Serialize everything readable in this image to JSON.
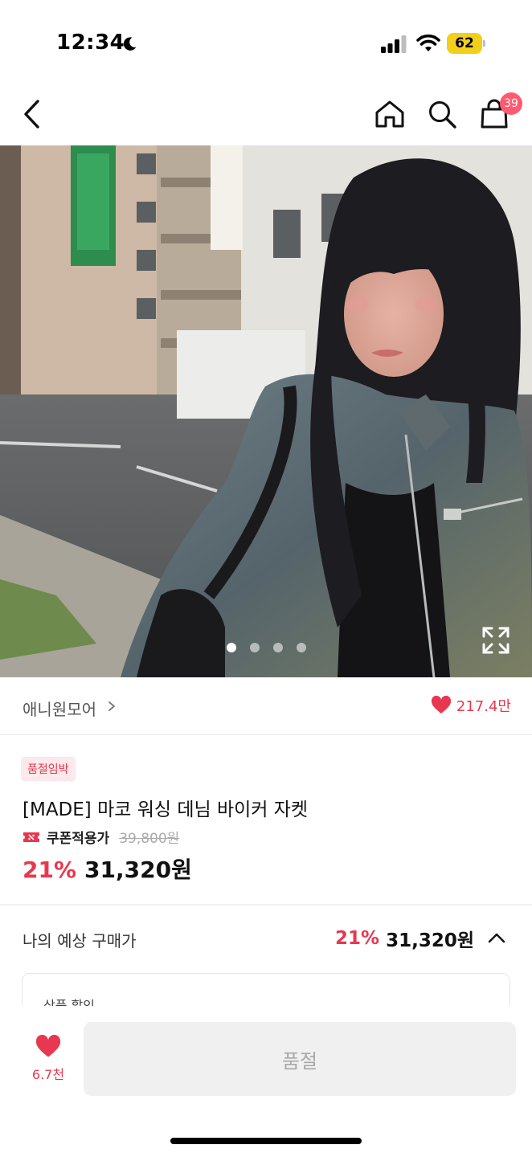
{
  "status_bar": {
    "time": "12:34",
    "battery": "62",
    "icons": [
      "moon-icon",
      "signal-icon",
      "wifi-icon",
      "battery-icon"
    ],
    "battery_color": "#f2cf1b"
  },
  "nav": {
    "icons": [
      "back-icon",
      "home-icon",
      "search-icon",
      "cart-icon"
    ],
    "cart_badge": "39"
  },
  "gallery": {
    "image": "photo of a woman with long black bangs wearing a washed denim biker jacket on a city street",
    "total_images": 4,
    "current_index": 1
  },
  "brand": {
    "name": "애니원모어",
    "likes": "217.4만"
  },
  "product": {
    "badge": "품절임박",
    "title": "[MADE] 마코 워싱 데님 바이커 자켓",
    "coupon_label": "쿠폰적용가",
    "original_price": "39,800원",
    "discount": "21%",
    "price": "31,320원"
  },
  "expected_price": {
    "label": "나의 예상 구매가",
    "discount": "21%",
    "price": "31,320원",
    "detail_label": "상품 할인"
  },
  "bottom": {
    "wish_count": "6.7천",
    "action_label": "품절"
  },
  "colors": {
    "accent": "#e8384f",
    "badge_bg": "#fde8eb",
    "cart_badge_bg": "#ff5a6f",
    "disabled_bg": "#f0f0f0"
  }
}
